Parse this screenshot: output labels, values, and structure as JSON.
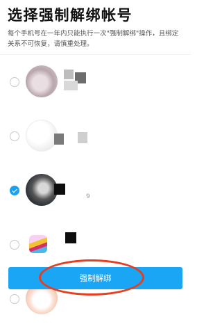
{
  "page": {
    "title": "选择强制解绑帐号",
    "description": "每个手机号在一年内只能执行一次\"强制解绑\"操作，且绑定关系不可恢复，请慎重处理。"
  },
  "accounts": [
    {
      "selected": false,
      "avatar": "blurred-avatar-portrait",
      "obscured_number": ""
    },
    {
      "selected": false,
      "avatar": "blurred-avatar-light",
      "obscured_number": ""
    },
    {
      "selected": true,
      "avatar": "blurred-avatar-dark",
      "obscured_number": "9"
    },
    {
      "selected": false,
      "avatar": "game-logo-avatar",
      "obscured_number": ""
    },
    {
      "selected": false,
      "avatar": "cartoon-sheep-avatar",
      "obscured_number": ""
    }
  ],
  "actions": {
    "force_unbind_label": "强制解绑"
  },
  "colors": {
    "accent": "#1aa5f5",
    "annotation_ring": "#e53e20"
  }
}
